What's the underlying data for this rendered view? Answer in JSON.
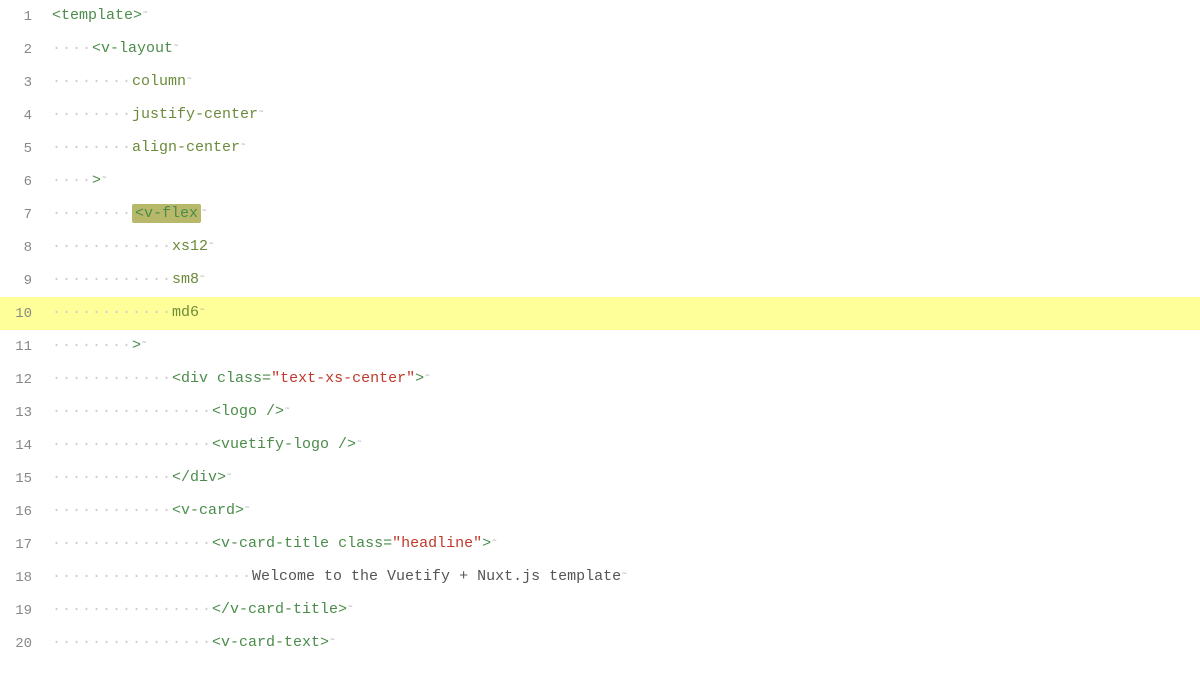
{
  "editor": {
    "background": "#ffffff",
    "highlight_color": "#ffff99",
    "lines": [
      {
        "number": 1,
        "indent": 0,
        "highlighted": false,
        "tokens": [
          {
            "type": "tag",
            "text": "<template>"
          },
          {
            "type": "text",
            "text": "↵"
          }
        ]
      },
      {
        "number": 2,
        "indent": 1,
        "highlighted": false,
        "tokens": [
          {
            "type": "tag",
            "text": "<v-layout"
          },
          {
            "type": "text",
            "text": "↵"
          }
        ]
      },
      {
        "number": 3,
        "indent": 2,
        "highlighted": false,
        "tokens": [
          {
            "type": "attr",
            "text": "column"
          },
          {
            "type": "text",
            "text": "↵"
          }
        ]
      },
      {
        "number": 4,
        "indent": 2,
        "highlighted": false,
        "tokens": [
          {
            "type": "attr",
            "text": "justify-center"
          },
          {
            "type": "text",
            "text": "↵"
          }
        ]
      },
      {
        "number": 5,
        "indent": 2,
        "highlighted": false,
        "tokens": [
          {
            "type": "attr",
            "text": "align-center"
          },
          {
            "type": "text",
            "text": "↵"
          }
        ]
      },
      {
        "number": 6,
        "indent": 1,
        "highlighted": false,
        "tokens": [
          {
            "type": "tag",
            "text": ">"
          },
          {
            "type": "text",
            "text": "↵"
          }
        ]
      },
      {
        "number": 7,
        "indent": 2,
        "highlighted": false,
        "tokens": [
          {
            "type": "tag_highlight",
            "text": "<v-flex"
          },
          {
            "type": "text",
            "text": "↵"
          }
        ]
      },
      {
        "number": 8,
        "indent": 3,
        "highlighted": false,
        "tokens": [
          {
            "type": "attr",
            "text": "xs12"
          },
          {
            "type": "text",
            "text": "↵"
          }
        ]
      },
      {
        "number": 9,
        "indent": 3,
        "highlighted": false,
        "tokens": [
          {
            "type": "attr",
            "text": "sm8"
          },
          {
            "type": "text",
            "text": "↵"
          }
        ]
      },
      {
        "number": 10,
        "indent": 3,
        "highlighted": true,
        "tokens": [
          {
            "type": "attr",
            "text": "md6"
          },
          {
            "type": "text",
            "text": "↵"
          }
        ]
      },
      {
        "number": 11,
        "indent": 2,
        "highlighted": false,
        "tokens": [
          {
            "type": "tag",
            "text": ">"
          },
          {
            "type": "text",
            "text": "↵"
          }
        ]
      },
      {
        "number": 12,
        "indent": 3,
        "highlighted": false,
        "tokens": [
          {
            "type": "tag",
            "text": "<div "
          },
          {
            "type": "attr_name",
            "text": "class="
          },
          {
            "type": "string",
            "text": "\"text-xs-center\""
          },
          {
            "type": "tag",
            "text": ">"
          },
          {
            "type": "text",
            "text": "↵"
          }
        ]
      },
      {
        "number": 13,
        "indent": 4,
        "highlighted": false,
        "tokens": [
          {
            "type": "tag",
            "text": "<logo />"
          },
          {
            "type": "text",
            "text": "↵"
          }
        ]
      },
      {
        "number": 14,
        "indent": 4,
        "highlighted": false,
        "tokens": [
          {
            "type": "tag",
            "text": "<vuetify-logo />"
          },
          {
            "type": "text",
            "text": "↵"
          }
        ]
      },
      {
        "number": 15,
        "indent": 3,
        "highlighted": false,
        "tokens": [
          {
            "type": "tag",
            "text": "</div>"
          },
          {
            "type": "text",
            "text": "↵"
          }
        ]
      },
      {
        "number": 16,
        "indent": 3,
        "highlighted": false,
        "tokens": [
          {
            "type": "tag",
            "text": "<v-card>"
          },
          {
            "type": "text",
            "text": "↵"
          }
        ]
      },
      {
        "number": 17,
        "indent": 4,
        "highlighted": false,
        "tokens": [
          {
            "type": "tag",
            "text": "<v-card-title "
          },
          {
            "type": "attr_name",
            "text": "class="
          },
          {
            "type": "string",
            "text": "\"headline\""
          },
          {
            "type": "tag",
            "text": ">"
          },
          {
            "type": "text",
            "text": "↵"
          }
        ]
      },
      {
        "number": 18,
        "indent": 5,
        "highlighted": false,
        "tokens": [
          {
            "type": "text",
            "text": "Welcome to the Vuetify + Nuxt.js template"
          },
          {
            "type": "text",
            "text": "↵"
          }
        ]
      },
      {
        "number": 19,
        "indent": 4,
        "highlighted": false,
        "tokens": [
          {
            "type": "tag",
            "text": "</v-card-title>"
          },
          {
            "type": "text",
            "text": "↵"
          }
        ]
      },
      {
        "number": 20,
        "indent": 4,
        "highlighted": false,
        "tokens": [
          {
            "type": "tag",
            "text": "<v-card-text>"
          },
          {
            "type": "text",
            "text": "↵"
          }
        ]
      }
    ]
  }
}
